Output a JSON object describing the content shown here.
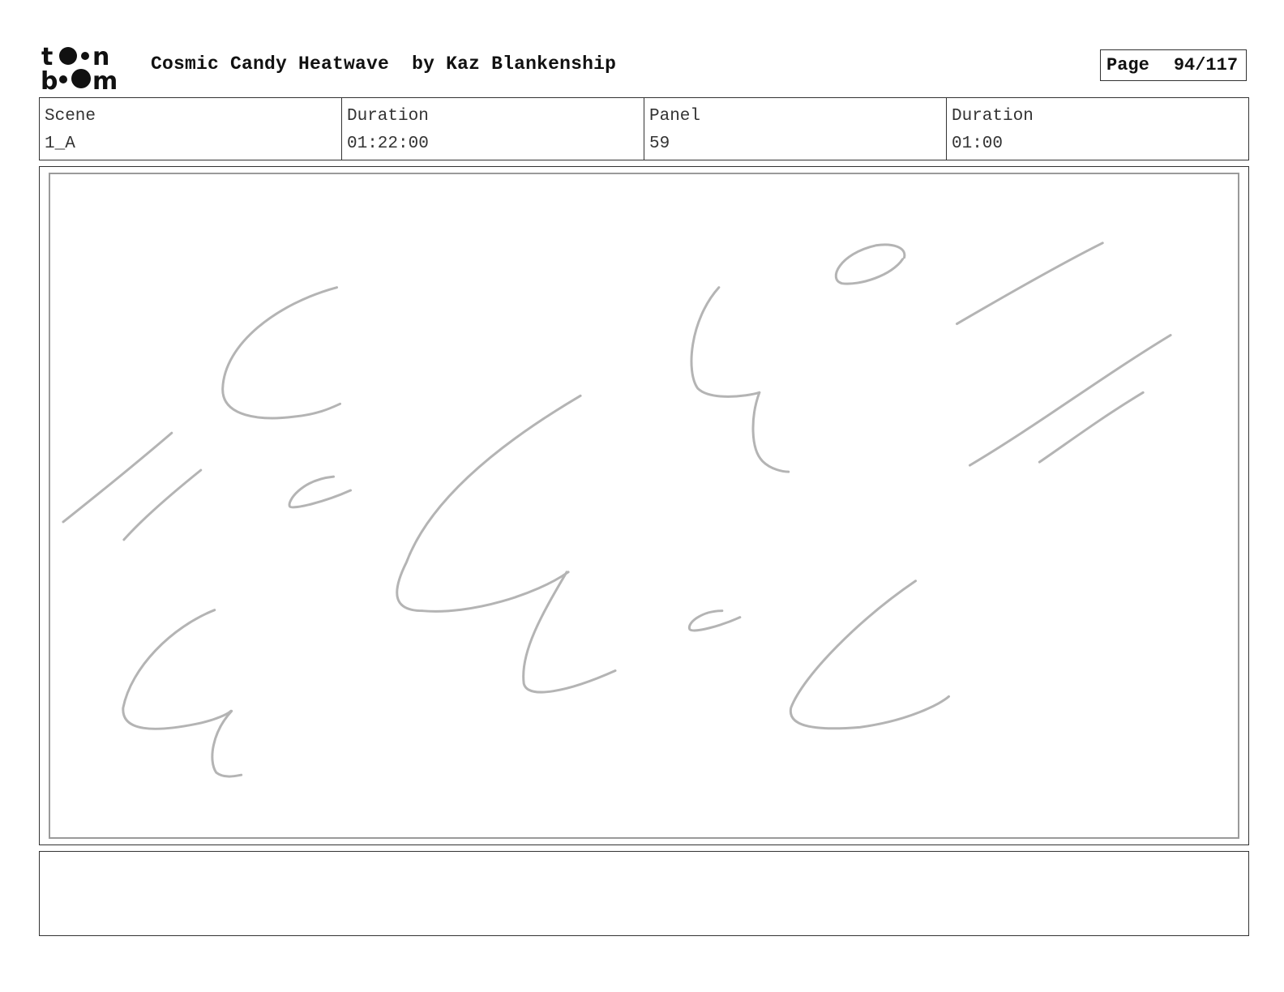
{
  "header": {
    "logo_top": "toon",
    "logo_bottom": "boom",
    "project_title": "Cosmic Candy Heatwave",
    "author": "by Kaz Blankenship",
    "page_label": "Page",
    "page_number": "94/117"
  },
  "info": {
    "scene_label": "Scene",
    "scene_value": "1_A",
    "scene_duration_label": "Duration",
    "scene_duration_value": "01:22:00",
    "panel_label": "Panel",
    "panel_value": "59",
    "panel_duration_label": "Duration",
    "panel_duration_value": "01:00"
  },
  "colors": {
    "sketch_stroke": "#b4b4b4",
    "frame_border": "#333333",
    "inner_border": "#9a9a9a"
  },
  "notes": {
    "text": ""
  }
}
